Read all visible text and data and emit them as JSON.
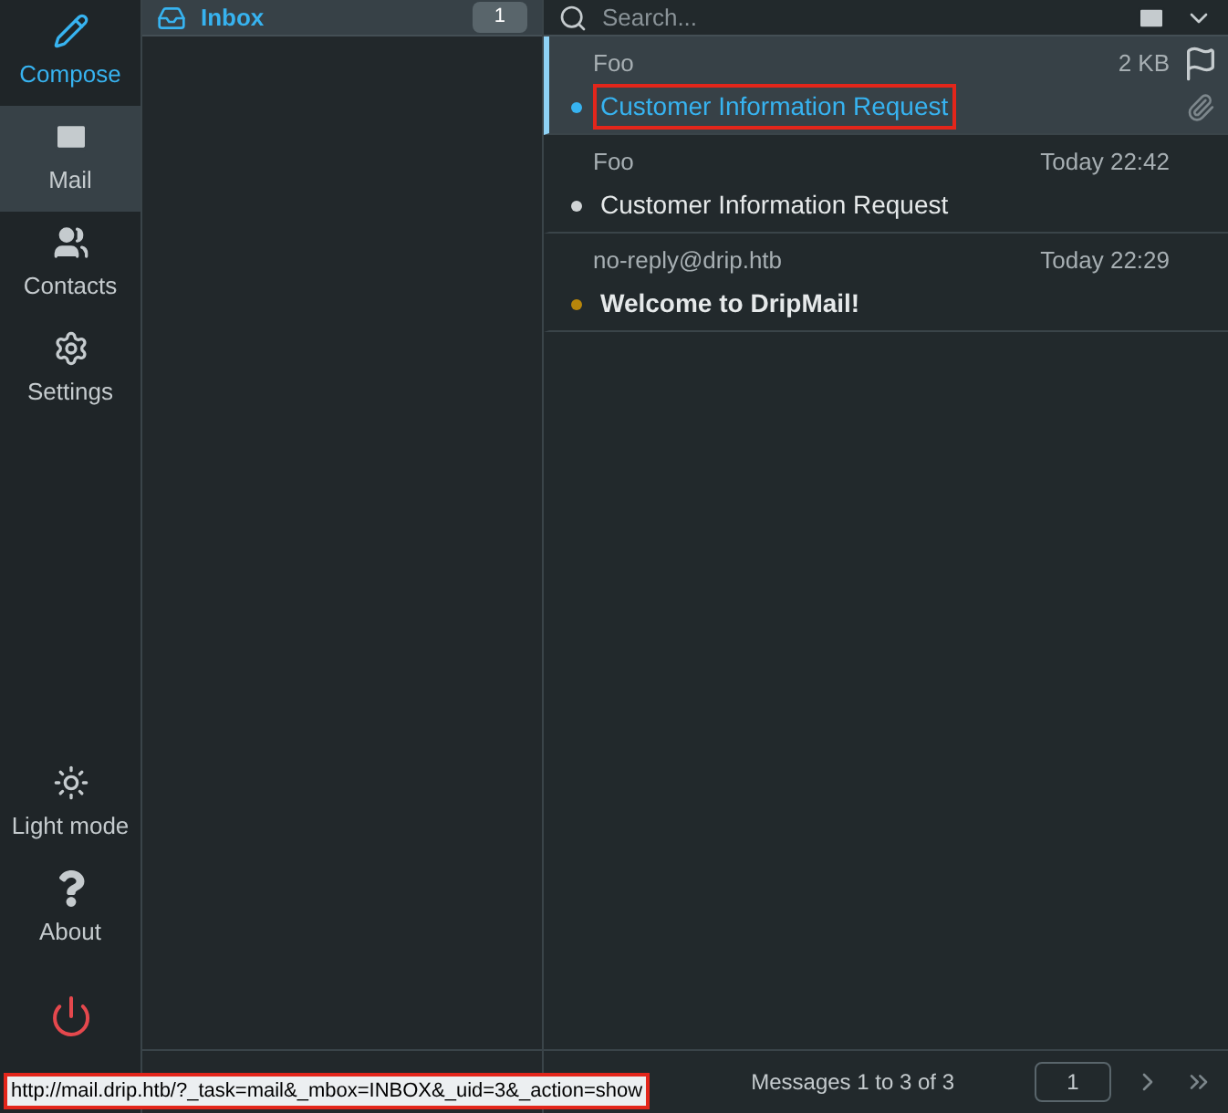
{
  "nav": [
    {
      "kind": "compose",
      "label": "Compose",
      "selected": false
    },
    {
      "kind": "mail",
      "label": "Mail",
      "selected": true
    },
    {
      "kind": "contacts",
      "label": "Contacts",
      "selected": false
    },
    {
      "kind": "settings",
      "label": "Settings",
      "selected": false
    }
  ],
  "nav_bottom": [
    {
      "kind": "light",
      "label": "Light mode"
    },
    {
      "kind": "about",
      "label": "About"
    },
    {
      "kind": "logout"
    }
  ],
  "folder": {
    "name": "Inbox",
    "count": "1"
  },
  "search": {
    "placeholder": "Search..."
  },
  "messages": [
    {
      "from": "Foo",
      "meta": "2 KB",
      "subject": "Customer Information Request",
      "selected": true,
      "unread": false,
      "flag": true,
      "attachment": true,
      "annotated": true,
      "color": "#37b3f0"
    },
    {
      "from": "Foo",
      "meta": "Today 22:42",
      "subject": "Customer Information Request",
      "selected": false,
      "unread": false,
      "flag": false,
      "attachment": false,
      "annotated": false,
      "color": "#d0d4d6"
    },
    {
      "from": "no-reply@drip.htb",
      "meta": "Today 22:29",
      "subject": "Welcome to DripMail!",
      "selected": false,
      "unread": true,
      "flag": false,
      "attachment": false,
      "annotated": false,
      "color": "#b8860b"
    }
  ],
  "pager": {
    "text": "Messages 1 to 3 of 3",
    "page": "1"
  },
  "status_url": "http://mail.drip.htb/?_task=mail&_mbox=INBOX&_uid=3&_action=show"
}
